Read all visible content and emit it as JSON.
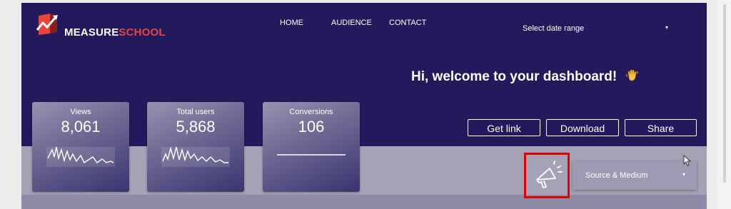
{
  "brand": {
    "part1": "MEASURE",
    "part2": "SCHOOL"
  },
  "nav": {
    "home": "HOME",
    "audience": "AUDIENCE",
    "contact": "CONTACT"
  },
  "date_range": {
    "label": "Select date range",
    "caret": "▾"
  },
  "welcome": {
    "text": "Hi, welcome to your dashboard!",
    "emoji": "👋"
  },
  "scorecards": [
    {
      "title": "Views",
      "value": "8,061"
    },
    {
      "title": "Total users",
      "value": "5,868"
    },
    {
      "title": "Conversions",
      "value": "106"
    }
  ],
  "actions": {
    "get_link": "Get link",
    "download": "Download",
    "share": "Share"
  },
  "filter": {
    "label": "Source & Medium",
    "caret": "▾"
  },
  "icons": {
    "logo": "measureschool-logo",
    "megaphone": "megaphone-icon",
    "cursor": "mouse-pointer-icon"
  },
  "colors": {
    "header_bg": "#221a5c",
    "lower_bg": "#a6a2b6",
    "brand_accent": "#e8453c",
    "highlight": "#e00000"
  }
}
